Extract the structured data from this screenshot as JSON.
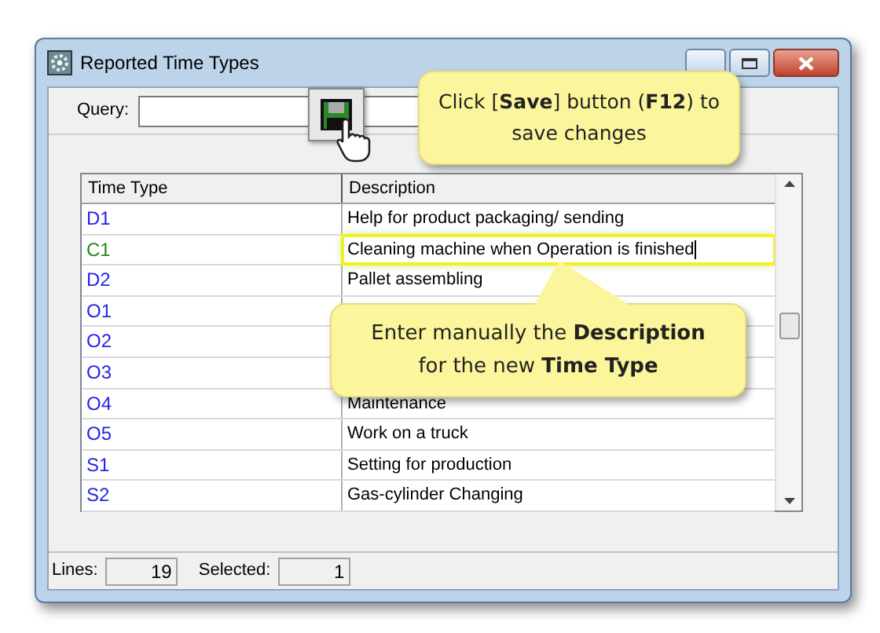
{
  "window": {
    "title": "Reported Time Types"
  },
  "query": {
    "label": "Query:"
  },
  "table": {
    "columns": [
      "Time Type",
      "Description"
    ],
    "rows": [
      {
        "time_type": "D1",
        "description": "Help for product packaging/ sending",
        "color": "#2424e8",
        "editing": false
      },
      {
        "time_type": "C1",
        "description": "Cleaning machine when Operation is finished",
        "color": "#1e8a1e",
        "editing": true
      },
      {
        "time_type": "D2",
        "description": "Pallet assembling",
        "color": "#2424e8",
        "editing": false
      },
      {
        "time_type": "O1",
        "color": "#2424e8",
        "editing": false
      },
      {
        "time_type": "O2",
        "color": "#2424e8",
        "editing": false
      },
      {
        "time_type": "O3",
        "color": "#2424e8",
        "editing": false
      },
      {
        "time_type": "O4",
        "description": "Maintenance",
        "color": "#2424e8",
        "editing": false
      },
      {
        "time_type": "O5",
        "description": "Work on a truck",
        "color": "#2424e8",
        "editing": false
      },
      {
        "time_type": "S1",
        "description": "Setting for production",
        "color": "#2424e8",
        "editing": false
      },
      {
        "time_type": "S2",
        "description": "Gas-cylinder Changing",
        "color": "#2424e8",
        "editing": false
      }
    ]
  },
  "status_bar": {
    "lines_label": "Lines:",
    "lines": "19",
    "selected_label": "Selected:",
    "selected": "1"
  },
  "callouts": [
    {
      "kind": "save",
      "text": "Click [**Save**] button (**F12**) to save changes"
    },
    {
      "kind": "description",
      "text": "Enter manually the **Description** for the new **Time Type**"
    }
  ]
}
